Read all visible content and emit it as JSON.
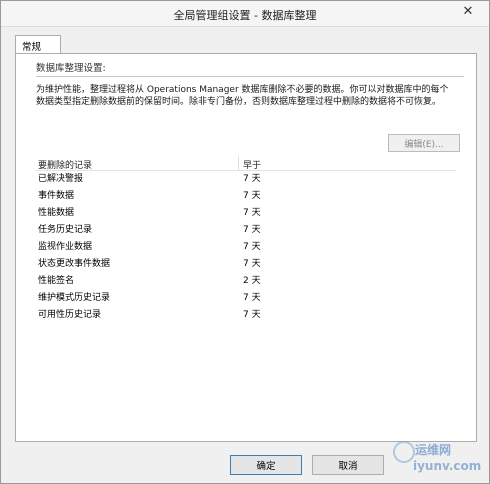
{
  "window": {
    "title": "全局管理组设置 - 数据库整理",
    "close_glyph": "✕"
  },
  "tabs": [
    {
      "label": "常规"
    }
  ],
  "section": {
    "title": "数据库整理设置:",
    "description": "为维护性能，整理过程将从 Operations Manager 数据库删除不必要的数据。你可以对数据库中的每个数据类型指定删除数据前的保留时间。除非专门备份，否则数据库整理过程中删除的数据将不可恢复。"
  },
  "edit_button": {
    "label": "编辑(E)..."
  },
  "list": {
    "columns": [
      "要删除的记录",
      "早于"
    ],
    "rows": [
      {
        "name": "已解决警报",
        "value": "7 天"
      },
      {
        "name": "事件数据",
        "value": "7 天"
      },
      {
        "name": "性能数据",
        "value": "7 天"
      },
      {
        "name": "任务历史记录",
        "value": "7 天"
      },
      {
        "name": "监视作业数据",
        "value": "7 天"
      },
      {
        "name": "状态更改事件数据",
        "value": "7 天"
      },
      {
        "name": "性能签名",
        "value": "2 天"
      },
      {
        "name": "维护模式历史记录",
        "value": "7 天"
      },
      {
        "name": "可用性历史记录",
        "value": "7 天"
      }
    ]
  },
  "buttons": {
    "ok": "确定",
    "cancel": "取消"
  },
  "watermark": {
    "line1": "运维网",
    "line2": "iyunv.com"
  }
}
